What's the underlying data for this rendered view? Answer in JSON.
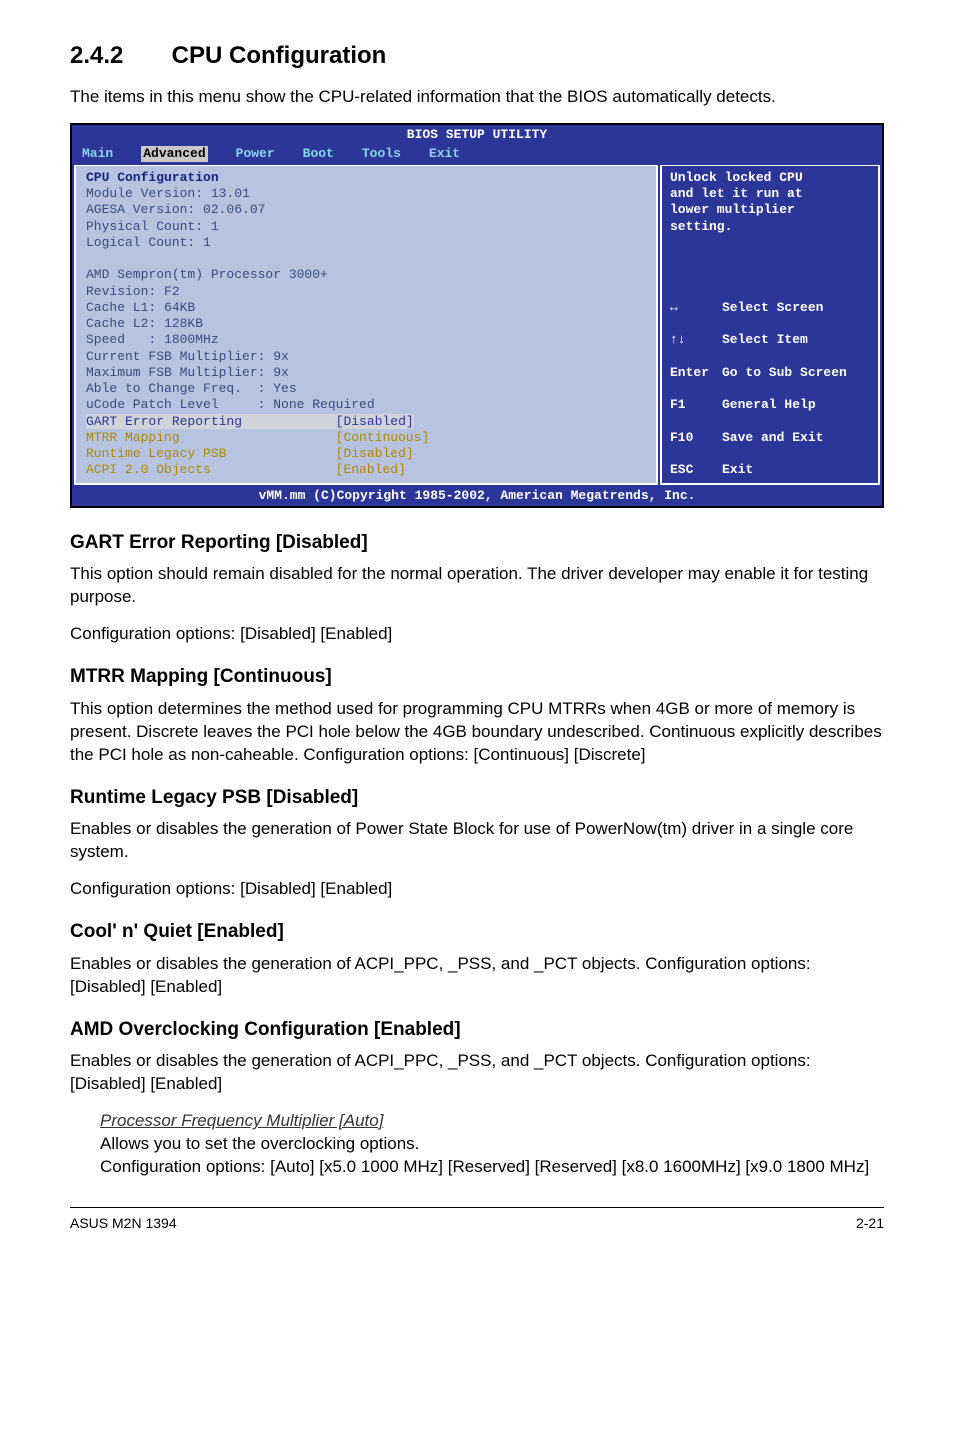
{
  "section": {
    "num": "2.4.2",
    "title": "CPU Configuration"
  },
  "intro": "The items in this menu show the CPU-related information that the BIOS automatically detects.",
  "bios": {
    "title": "BIOS SETUP UTILITY",
    "tabs": [
      "Main",
      "Advanced",
      "Power",
      "Boot",
      "Tools",
      "Exit"
    ],
    "active_tab": 1,
    "left": {
      "header": "CPU Configuration",
      "info": [
        "Module Version: 13.01",
        "AGESA Version: 02.06.07",
        "Physical Count: 1",
        "Logical Count: 1",
        "",
        "AMD Sempron(tm) Processor 3000+",
        "Revision: F2",
        "Cache L1: 64KB",
        "Cache L2: 128KB",
        "Speed   : 1800MHz",
        "Current FSB Multiplier: 9x",
        "Maximum FSB Multiplier: 9x",
        "Able to Change Freq.  : Yes",
        "uCode Patch Level     : None Required"
      ],
      "opts": [
        {
          "label": "GART Error Reporting",
          "value": "[Disabled]",
          "sel": true
        },
        {
          "label": "MTRR Mapping",
          "value": "[Continuous]"
        },
        {
          "label": "Runtime Legacy PSB",
          "value": "[Disabled]"
        },
        {
          "label": "ACPI 2.0 Objects",
          "value": "[Enabled]"
        }
      ]
    },
    "right": {
      "help": "Unlock locked CPU\nand let it run at\nlower multiplier\nsetting.",
      "keys": [
        {
          "k": "↔",
          "l": "Select Screen"
        },
        {
          "k": "↑↓",
          "l": "Select Item"
        },
        {
          "k": "Enter",
          "l": "Go to Sub Screen"
        },
        {
          "k": "F1",
          "l": "General Help"
        },
        {
          "k": "F10",
          "l": "Save and Exit"
        },
        {
          "k": "ESC",
          "l": "Exit"
        }
      ]
    },
    "footer": "vMM.mm (C)Copyright 1985-2002, American Megatrends, Inc."
  },
  "sections": {
    "gart": {
      "h": "GART Error Reporting [Disabled]",
      "p1": "This option should remain disabled for the normal operation. The driver developer may enable it for testing purpose.",
      "p2": "Configuration options: [Disabled] [Enabled]"
    },
    "mtrr": {
      "h": "MTRR Mapping [Continuous]",
      "p1": "This option determines the method used for programming CPU MTRRs when 4GB or more of memory is present. Discrete leaves the PCI hole below the 4GB boundary undescribed. Continuous explicitly describes the PCI hole as non-caheable. Configuration options: [Continuous] [Discrete]"
    },
    "runtime": {
      "h": "Runtime Legacy PSB [Disabled]",
      "p1": "Enables or disables the generation of Power State Block for use of PowerNow(tm) driver in a single core system.",
      "p2": "Configuration options: [Disabled] [Enabled]"
    },
    "cool": {
      "h": "Cool' n' Quiet [Enabled]",
      "p1": "Enables or disables the generation of ACPI_PPC, _PSS, and _PCT objects. Configuration options: [Disabled] [Enabled]"
    },
    "amd": {
      "h": "AMD Overclocking Configuration [Enabled]",
      "p1": "Enables or disables the generation of ACPI_PPC, _PSS, and _PCT objects. Configuration options: [Disabled] [Enabled]",
      "sub_h": "Processor Frequency Multiplier [Auto]",
      "sub_p1": "Allows you to set the overclocking options.",
      "sub_p2": "Configuration options: [Auto] [x5.0 1000 MHz] [Reserved] [Reserved] [x8.0 1600MHz] [x9.0 1800 MHz]"
    }
  },
  "footer": {
    "left": "ASUS M2N 1394",
    "right": "2-21"
  }
}
